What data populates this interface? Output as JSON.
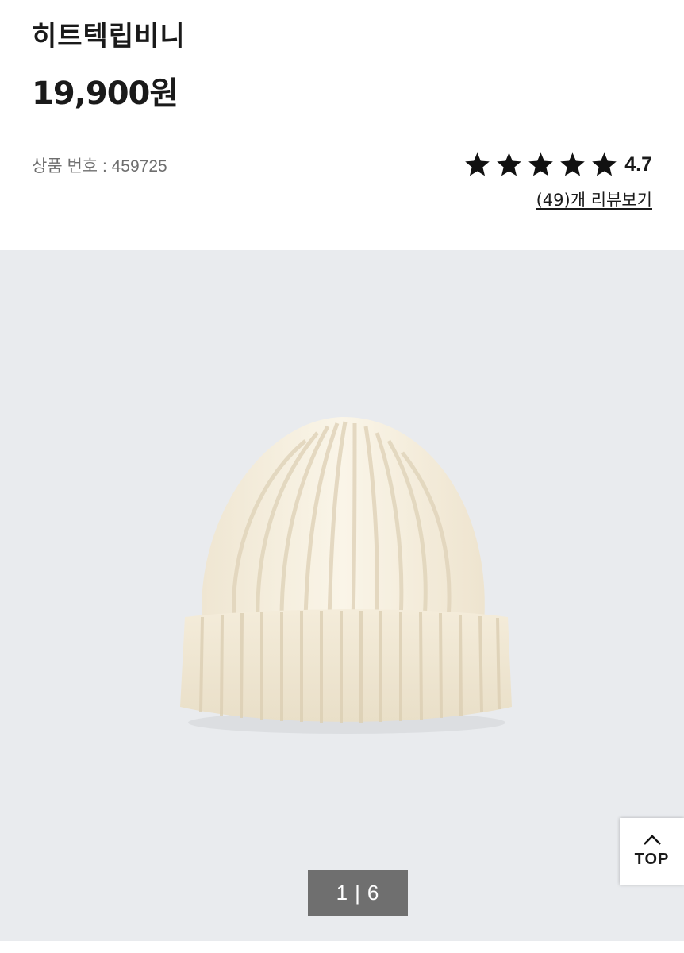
{
  "product": {
    "name": "히트텍립비니",
    "price": "19,900원",
    "product_number": "상품 번호 : 459725"
  },
  "rating": {
    "stars": 5,
    "value": "4.7",
    "reviews_link": "(49)개 리뷰보기"
  },
  "gallery": {
    "image_icon": "knit-beanie-product-image",
    "background_color": "#e9ebee",
    "current": "1",
    "separator": "|",
    "total": "6"
  },
  "top_button": {
    "icon": "chevron-up-icon",
    "label": "TOP"
  }
}
